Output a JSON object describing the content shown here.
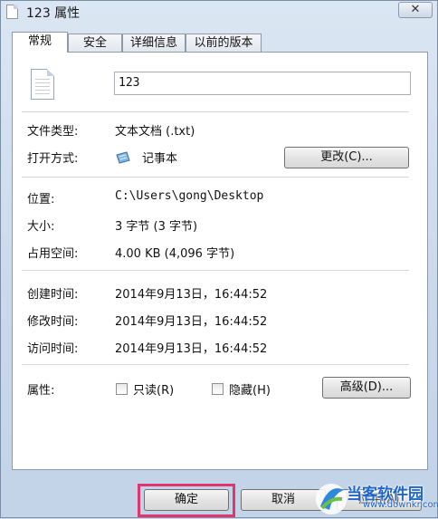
{
  "window": {
    "title": "123 属性",
    "close_glyph": "✕"
  },
  "tabs": [
    {
      "label": "常规",
      "active": true
    },
    {
      "label": "安全",
      "active": false
    },
    {
      "label": "详细信息",
      "active": false
    },
    {
      "label": "以前的版本",
      "active": false
    }
  ],
  "general": {
    "file_name": "123",
    "file_type_label": "文件类型:",
    "file_type_value": "文本文档 (.txt)",
    "opens_with_label": "打开方式:",
    "opens_with_value": "记事本",
    "change_button": "更改(C)...",
    "location_label": "位置:",
    "location_value": "C:\\Users\\gong\\Desktop",
    "size_label": "大小:",
    "size_value": "3 字节 (3 字节)",
    "size_on_disk_label": "占用空间:",
    "size_on_disk_value": "4.00 KB (4,096 字节)",
    "created_label": "创建时间:",
    "created_value": "2014年9月13日，16:44:52",
    "modified_label": "修改时间:",
    "modified_value": "2014年9月13日，16:44:52",
    "accessed_label": "访问时间:",
    "accessed_value": "2014年9月13日，16:44:52",
    "attributes_label": "属性:",
    "readonly_label": "只读(R)",
    "hidden_label": "隐藏(H)",
    "advanced_button": "高级(D)..."
  },
  "footer": {
    "ok_button": "确定",
    "cancel_button": "取消",
    "apply_button": "应用(A)"
  },
  "watermark": {
    "name": "当客软件园",
    "url": "www.downkr.com"
  },
  "colors": {
    "highlight": "#e0356d",
    "watermark": "#1f66c9"
  }
}
